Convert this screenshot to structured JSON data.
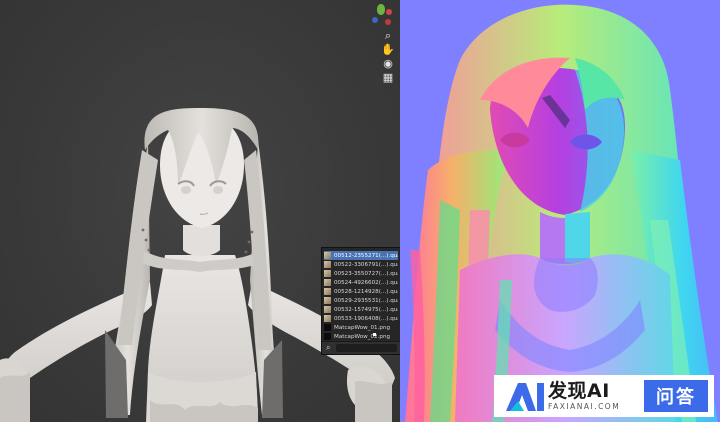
{
  "viewport": {
    "tools": [
      {
        "icon": "zoom-icon",
        "glyph": "⌕"
      },
      {
        "icon": "hand-pan-icon",
        "glyph": "✋"
      },
      {
        "icon": "camera-icon",
        "glyph": "◉"
      },
      {
        "icon": "grid-icon",
        "glyph": "▦"
      }
    ],
    "gizmo_colors": {
      "green": "#6db33f",
      "red": "#d24545",
      "blue": "#3e66c4"
    }
  },
  "image_browser": {
    "items": [
      {
        "label": "00512-2355271(...).quality",
        "thumb": "light",
        "active": true
      },
      {
        "label": "00522-3306791(...).quality",
        "thumb": "light",
        "active": false
      },
      {
        "label": "00523-3550727(...).quality",
        "thumb": "light",
        "active": false
      },
      {
        "label": "00524-4926602(...).quality",
        "thumb": "light",
        "active": false
      },
      {
        "label": "00528-1214928(...).quality",
        "thumb": "light",
        "active": false
      },
      {
        "label": "00529-2935531(...).quality",
        "thumb": "light",
        "active": false
      },
      {
        "label": "00532-1574975(...).quality",
        "thumb": "light",
        "active": false
      },
      {
        "label": "00533-1906408(...).quality",
        "thumb": "light",
        "active": false
      },
      {
        "label": "MatcapWow_01.png",
        "thumb": "dark",
        "active": false
      },
      {
        "label": "MatcapWow_02.png",
        "thumb": "dark",
        "active": false
      }
    ],
    "search_icon": "search-icon"
  },
  "watermark": {
    "title": "发现AI",
    "subtitle": "FAXIANAI.COM",
    "badge": "问答",
    "accent": "#3b6be8"
  }
}
